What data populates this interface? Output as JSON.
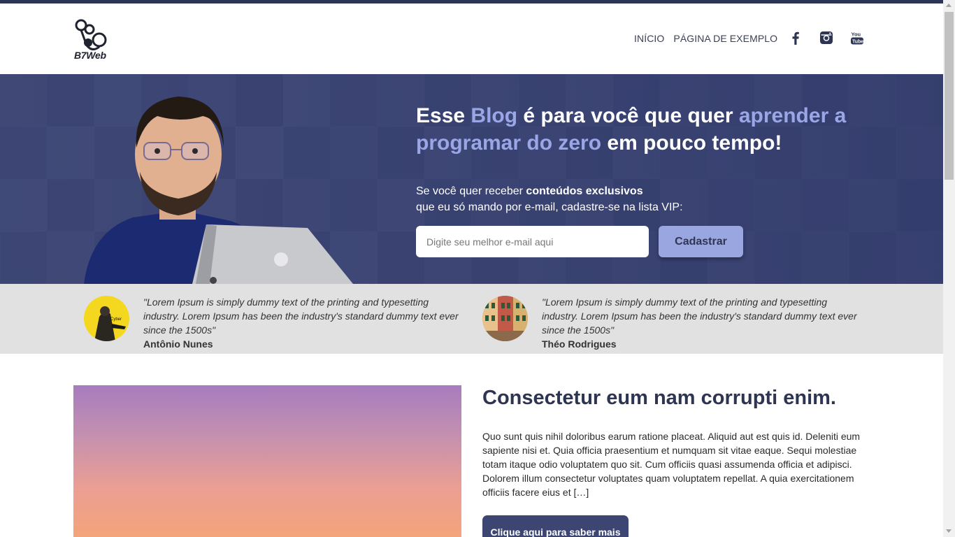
{
  "header": {
    "logo_text": "B7Web",
    "nav": [
      {
        "label": "INÍCIO"
      },
      {
        "label": "PÁGINA DE EXEMPLO"
      }
    ],
    "social": [
      "facebook-icon",
      "instagram-icon",
      "youtube-icon"
    ]
  },
  "hero": {
    "title_parts": [
      "Esse ",
      "Blog",
      " é para você que quer ",
      "aprender a programar do zero",
      " em pouco tempo!"
    ],
    "subtitle_prefix": "Se você quer receber ",
    "subtitle_bold": "conteúdos exclusivos",
    "subtitle_line2": "que eu só mando por e-mail, cadastre-se na lista VIP:",
    "email_placeholder": "Digite seu melhor e-mail aqui",
    "signup_label": "Cadastrar"
  },
  "testimonials": [
    {
      "quote": "\"Lorem Ipsum is simply dummy text of the printing and typesetting industry. Lorem Ipsum has been the industry's standard dummy text ever since the 1500s\"",
      "author": "Antônio Nunes"
    },
    {
      "quote": "\"Lorem Ipsum is simply dummy text of the printing and typesetting industry. Lorem Ipsum has been the industry's standard dummy text ever since the 1500s\"",
      "author": "Théo Rodrigues"
    }
  ],
  "post": {
    "title": "Consectetur eum nam corrupti enim.",
    "body": "Quo sunt quis nihil doloribus earum ratione placeat. Aliquid aut est quis id. Deleniti eum sapiente nisi et. Quia officia praesentium et numquam sit vitae eaque. Sequi molestiae totam itaque odio voluptatem quo sit. Cum officiis quasi assumenda officia et adipisci. Dolorem illum consectetur voluptates quam voluptatem repellat. A quia exercitationem officiis facere eius et […]",
    "button_label": "Clique aqui para saber mais"
  },
  "colors": {
    "brand_dark": "#2e3552",
    "hero_bg": "#3d4673",
    "accent": "#9aa6e6",
    "testimonial_bg": "#e1e1e1"
  }
}
